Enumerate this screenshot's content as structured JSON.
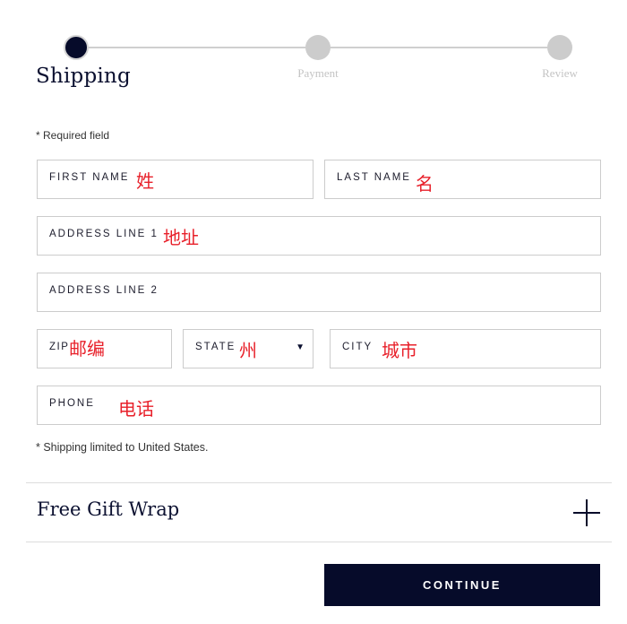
{
  "stepper": {
    "steps": [
      {
        "label": "Shipping",
        "state": "active"
      },
      {
        "label": "Payment",
        "state": "inactive"
      },
      {
        "label": "Review",
        "state": "inactive"
      }
    ],
    "active_color": "#060b2a",
    "inactive_color": "#cccccc"
  },
  "form": {
    "required_note": "* Required field",
    "fields": {
      "first_name": {
        "label": "FIRST NAME",
        "value": "姓"
      },
      "last_name": {
        "label": "LAST NAME",
        "value": "名"
      },
      "address_line_1": {
        "label": "ADDRESS LINE 1",
        "value": "地址"
      },
      "address_line_2": {
        "label": "ADDRESS LINE 2",
        "value": ""
      },
      "zip": {
        "label": "ZIP",
        "value": "邮编"
      },
      "state": {
        "label": "STATE",
        "value": "州",
        "icon": "caret-down-icon"
      },
      "city": {
        "label": "CITY",
        "value": "城市"
      },
      "phone": {
        "label": "PHONE",
        "value": "电话"
      }
    },
    "shipping_note": "* Shipping limited to United States."
  },
  "gift_wrap": {
    "title": "Free Gift Wrap",
    "icon": "plus-icon"
  },
  "actions": {
    "continue_label": "CONTINUE",
    "button_color": "#060b2a"
  },
  "annotation_color": "#e8202a"
}
